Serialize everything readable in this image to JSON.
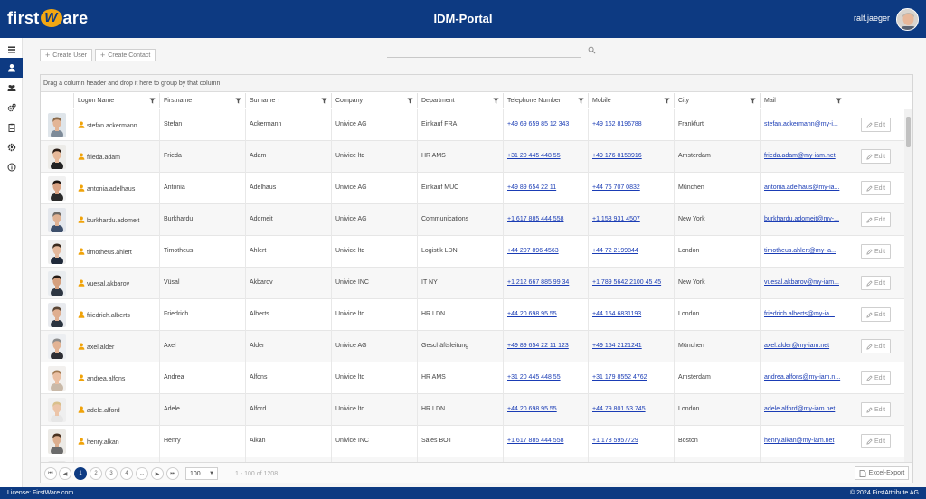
{
  "header": {
    "logo_text_left": "first",
    "logo_text_w": "W",
    "logo_text_right": "are",
    "title": "IDM-Portal",
    "username": "ralf.jaeger"
  },
  "sidebar": {
    "items": [
      {
        "icon": "menu-icon",
        "active": false
      },
      {
        "icon": "user-icon",
        "active": true
      },
      {
        "icon": "users-group-icon",
        "active": false
      },
      {
        "icon": "gears-icon",
        "active": false
      },
      {
        "icon": "clipboard-icon",
        "active": false
      },
      {
        "icon": "settings-gear-icon",
        "active": false
      },
      {
        "icon": "info-icon",
        "active": false
      }
    ]
  },
  "toolbar": {
    "create_user": "Create User",
    "create_contact": "Create Contact",
    "search_placeholder": ""
  },
  "grid": {
    "group_hint": "Drag a column header and drop it here to group by that column",
    "columns": [
      "Logon Name",
      "Firstname",
      "Surname",
      "Company",
      "Department",
      "Telephone Number",
      "Mobile",
      "City",
      "Mail"
    ],
    "sorted_column": "Surname",
    "sort_indicator": "↑",
    "edit_label": "Edit",
    "rows": [
      {
        "logon": "stefan.ackermann",
        "first": "Stefan",
        "surname": "Ackermann",
        "company": "Univice AG",
        "dept": "Einkauf FRA",
        "phone": "+49 69 659 85 12 343",
        "mobile": "+49 162 8196788",
        "city": "Frankfurt",
        "mail": "stefan.ackermann@my-i...",
        "photo": {
          "bg": "#dfe5ea",
          "skin": "#e3b596",
          "hair": "#8a6a4a",
          "shirt": "#7d8a98"
        }
      },
      {
        "logon": "frieda.adam",
        "first": "Frieda",
        "surname": "Adam",
        "company": "Univice ltd",
        "dept": "HR AMS",
        "phone": "+31 20 445 448 55",
        "mobile": "+49 176 8158916",
        "city": "Amsterdam",
        "mail": "frieda.adam@my-iam.net",
        "photo": {
          "bg": "#ecebe8",
          "skin": "#e6b99a",
          "hair": "#2b1d16",
          "shirt": "#222222"
        }
      },
      {
        "logon": "antonia.adelhaus",
        "first": "Antonia",
        "surname": "Adelhaus",
        "company": "Univice AG",
        "dept": "Einkauf MUC",
        "phone": "+49 89 654 22 11",
        "mobile": "+44 76 707 0832",
        "city": "München",
        "mail": "antonia.adelhaus@my-ia...",
        "photo": {
          "bg": "#f1f1f1",
          "skin": "#d9a283",
          "hair": "#1e1410",
          "shirt": "#2a2a2a"
        }
      },
      {
        "logon": "burkhardu.adomeit",
        "first": "Burkhardu",
        "surname": "Adomeit",
        "company": "Univice AG",
        "dept": "Communications",
        "phone": "+1 617 885 444 558",
        "mobile": "+1 153 931 4507",
        "city": "New York",
        "mail": "burkhardu.adomeit@my-...",
        "photo": {
          "bg": "#e4e7ec",
          "skin": "#e0b293",
          "hair": "#6e6a66",
          "shirt": "#3d4f6b"
        }
      },
      {
        "logon": "timotheus.ahlert",
        "first": "Timotheus",
        "surname": "Ahlert",
        "company": "Univice ltd",
        "dept": "Logistik LDN",
        "phone": "+44 207 896 4563",
        "mobile": "+44 72 2199844",
        "city": "London",
        "mail": "timotheus.ahlert@my-ia...",
        "photo": {
          "bg": "#eeeeee",
          "skin": "#e4b89b",
          "hair": "#3a2a1e",
          "shirt": "#202a3a"
        }
      },
      {
        "logon": "vuesal.akbarov",
        "first": "Vüsal",
        "surname": "Akbarov",
        "company": "Univice INC",
        "dept": "IT NY",
        "phone": "+1 212 667 885 99 34",
        "mobile": "+1 789 5642 2100 45 45",
        "city": "New York",
        "mail": "vuesal.akbarov@my-iam...",
        "photo": {
          "bg": "#e9ecef",
          "skin": "#d5a07e",
          "hair": "#241a14",
          "shirt": "#2d3642"
        }
      },
      {
        "logon": "friedrich.alberts",
        "first": "Friedrich",
        "surname": "Alberts",
        "company": "Univice ltd",
        "dept": "HR LDN",
        "phone": "+44 20 698 95 55",
        "mobile": "+44 154 6831193",
        "city": "London",
        "mail": "friedrich.alberts@my-ia...",
        "photo": {
          "bg": "#e8eaee",
          "skin": "#dfae90",
          "hair": "#5a4636",
          "shirt": "#2b3440"
        }
      },
      {
        "logon": "axel.alder",
        "first": "Axel",
        "surname": "Alder",
        "company": "Univice AG",
        "dept": "Geschäftsleitung",
        "phone": "+49 89 654 22 11 123",
        "mobile": "+49 154 2121241",
        "city": "München",
        "mail": "axel.alder@my-iam.net",
        "photo": {
          "bg": "#eceef1",
          "skin": "#e2b394",
          "hair": "#8c8c8c",
          "shirt": "#2e2e34"
        }
      },
      {
        "logon": "andrea.alfons",
        "first": "Andrea",
        "surname": "Alfons",
        "company": "Univice ltd",
        "dept": "HR AMS",
        "phone": "+31 20 445 448 55",
        "mobile": "+31 179 8552 4762",
        "city": "Amsterdam",
        "mail": "andrea.alfons@my-iam.n...",
        "photo": {
          "bg": "#f2f0ee",
          "skin": "#eabfa2",
          "hair": "#a07850",
          "shirt": "#c9b9a8"
        }
      },
      {
        "logon": "adele.alford",
        "first": "Adele",
        "surname": "Alford",
        "company": "Univice ltd",
        "dept": "HR LDN",
        "phone": "+44 20 698 95 55",
        "mobile": "+44 79 801 53 745",
        "city": "London",
        "mail": "adele.alford@my-iam.net",
        "photo": {
          "bg": "#efefef",
          "skin": "#ecc5a9",
          "hair": "#d9c08c",
          "shirt": "#e6e6e6"
        }
      },
      {
        "logon": "henry.alkan",
        "first": "Henry",
        "surname": "Alkan",
        "company": "Univice INC",
        "dept": "Sales BOT",
        "phone": "+1 617 885 444 558",
        "mobile": "+1 178 5957729",
        "city": "Boston",
        "mail": "henry.alkan@my-iam.net",
        "photo": {
          "bg": "#eceae6",
          "skin": "#dcae8e",
          "hair": "#4a3322",
          "shirt": "#6b6b6b"
        }
      },
      {
        "logon": "",
        "first": "",
        "surname": "",
        "company": "",
        "dept": "",
        "phone": "",
        "mobile": "",
        "city": "",
        "mail": "",
        "photo": {
          "bg": "#e8e8e8",
          "skin": "#dfb294",
          "hair": "#2a2a2a",
          "shirt": "#444444"
        }
      }
    ]
  },
  "pager": {
    "first": "⏮",
    "prev": "◀",
    "pages": [
      "1",
      "2",
      "3",
      "4",
      "..."
    ],
    "active_page": "1",
    "next": "▶",
    "last": "⏭",
    "page_size": "100",
    "info": "1 - 100 of 1208",
    "excel_export": "Excel-Export"
  },
  "footer": {
    "license": "License: FirstWare.com",
    "copyright": "© 2024 FirstAttribute AG"
  }
}
